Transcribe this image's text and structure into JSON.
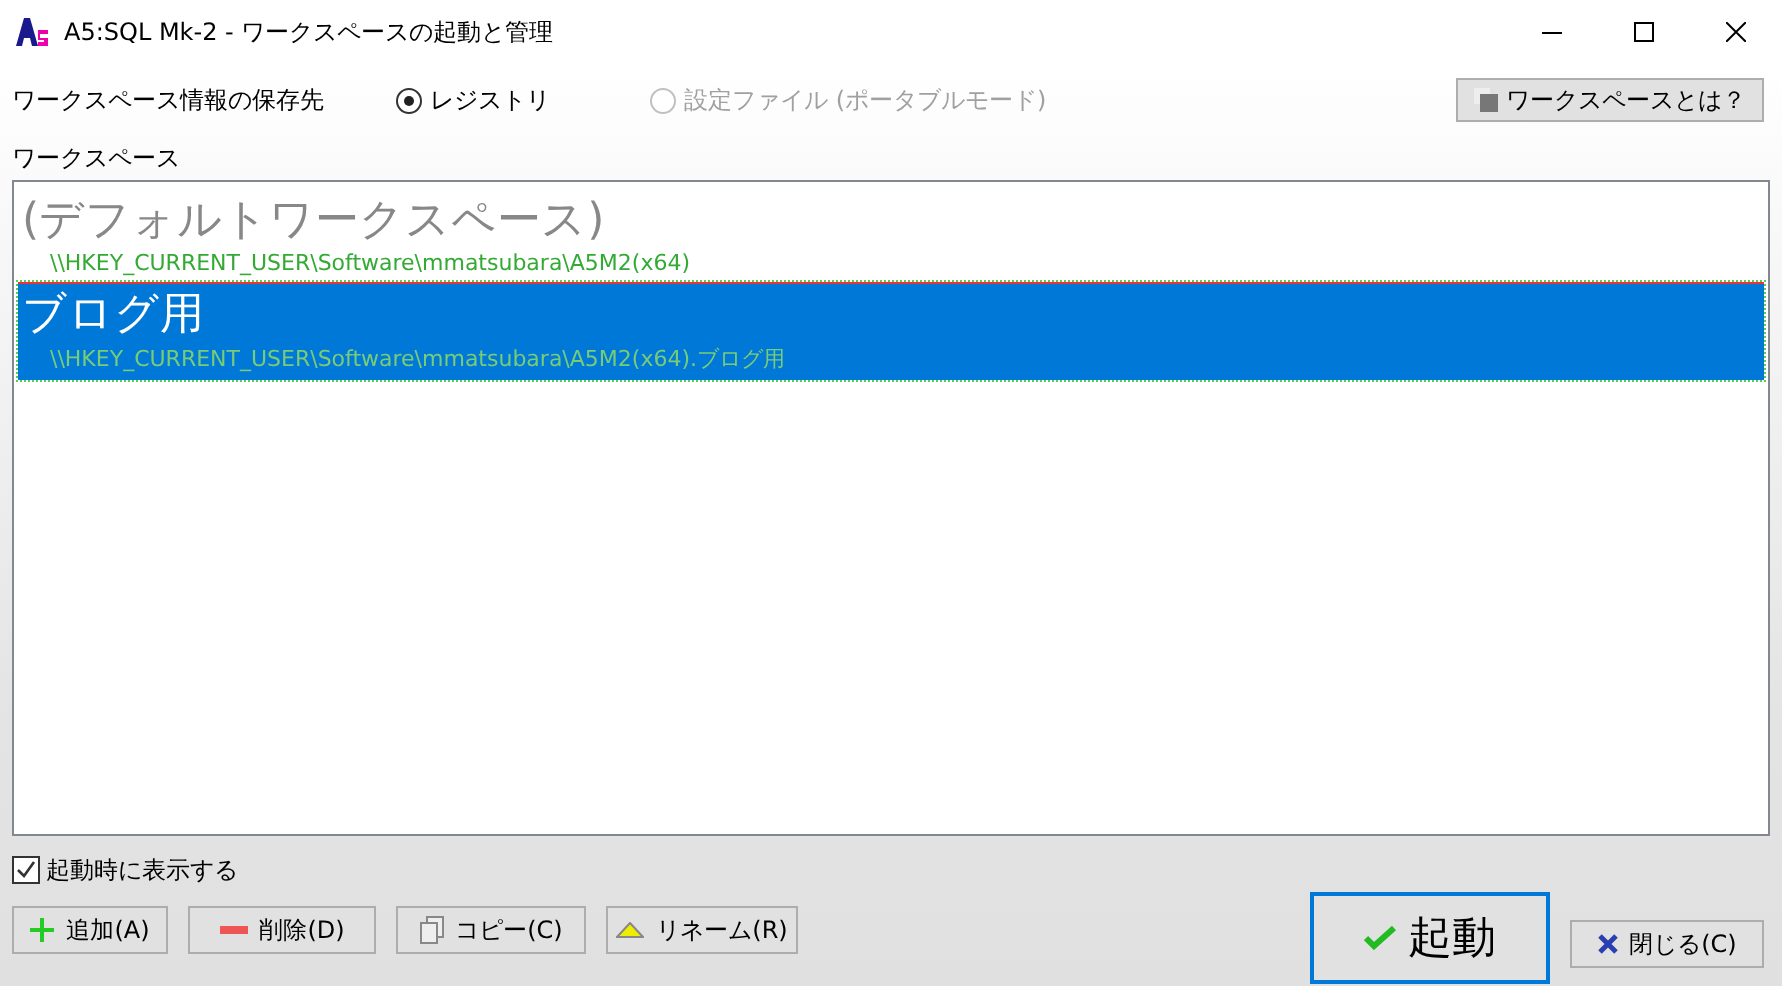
{
  "window": {
    "title": "A5:SQL Mk-2 - ワークスペースの起動と管理"
  },
  "storage": {
    "label": "ワークスペース情報の保存先",
    "options": [
      {
        "label": "レジストリ",
        "selected": true,
        "disabled": false
      },
      {
        "label": "設定ファイル (ポータブルモード)",
        "selected": false,
        "disabled": true
      }
    ],
    "help_button": "ワークスペースとは？"
  },
  "workspaces": {
    "label": "ワークスペース",
    "items": [
      {
        "name": "(デフォルトワークスペース)",
        "path": "\\\\HKEY_CURRENT_USER\\Software\\mmatsubara\\A5M2(x64)",
        "selected": false
      },
      {
        "name": "ブログ用",
        "path": "\\\\HKEY_CURRENT_USER\\Software\\mmatsubara\\A5M2(x64).ブログ用",
        "selected": true
      }
    ]
  },
  "show_on_startup": {
    "label": "起動時に表示する",
    "checked": true
  },
  "buttons": [
    {
      "kind": "add",
      "label": "追加(A)"
    },
    {
      "kind": "delete",
      "label": "削除(D)"
    },
    {
      "kind": "copy",
      "label": "コピー(C)"
    },
    {
      "kind": "rename",
      "label": "リネーム(R)"
    }
  ],
  "start_button": "起動",
  "close_button": "閉じる(C)"
}
